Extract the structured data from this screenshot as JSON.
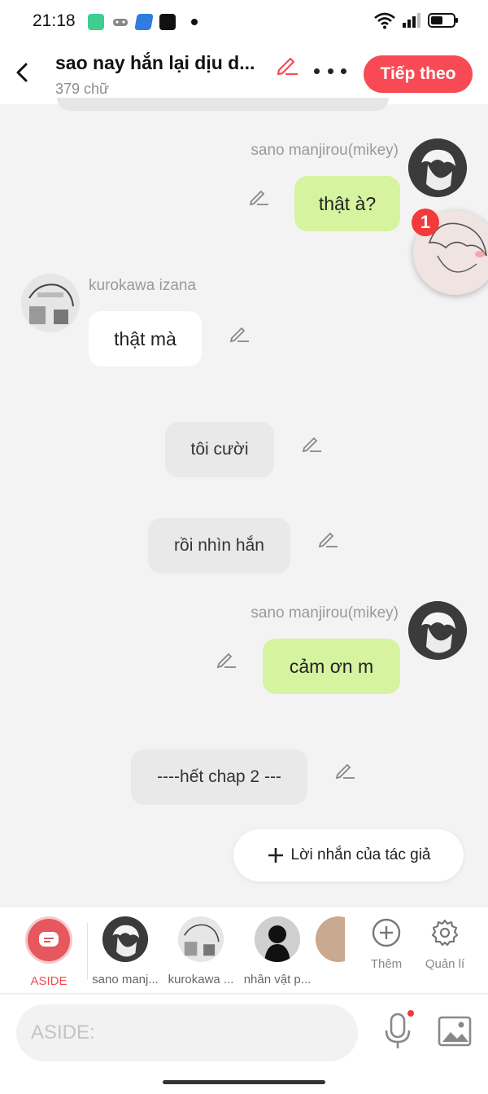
{
  "status_bar": {
    "time": "21:18",
    "icons": [
      "calculator-app-icon",
      "gamepad-icon",
      "app-icon",
      "bao-moi-icon",
      "notification-dot",
      "wifi-icon",
      "signal-icon",
      "battery-icon"
    ]
  },
  "header": {
    "title": "sao nay hắn lại dịu d...",
    "word_count": "379 chữ",
    "next_button": "Tiếp theo",
    "accent_color": "#f84a55"
  },
  "floating_bubble": {
    "badge_count": "1"
  },
  "messages": [
    {
      "type": "right",
      "name": "sano manjirou(mikey)",
      "text": "thật à?"
    },
    {
      "type": "left",
      "name": "kurokawa izana",
      "text": "thật mà"
    },
    {
      "type": "narration",
      "text": "tôi cười"
    },
    {
      "type": "narration",
      "text": "rồi nhìn hắn"
    },
    {
      "type": "right",
      "name": "sano manjirou(mikey)",
      "text": "cảm ơn m"
    },
    {
      "type": "narration",
      "text": "----hết chap 2 ---"
    }
  ],
  "author_note_button": "Lời nhắn của tác giả",
  "characters": [
    {
      "label": "ASIDE"
    },
    {
      "label": "sano manj..."
    },
    {
      "label": "kurokawa ..."
    },
    {
      "label": "nhân vật p..."
    }
  ],
  "tools": {
    "more_label": "Thêm",
    "manage_label": "Quản lí"
  },
  "input": {
    "placeholder": "ASIDE:"
  }
}
